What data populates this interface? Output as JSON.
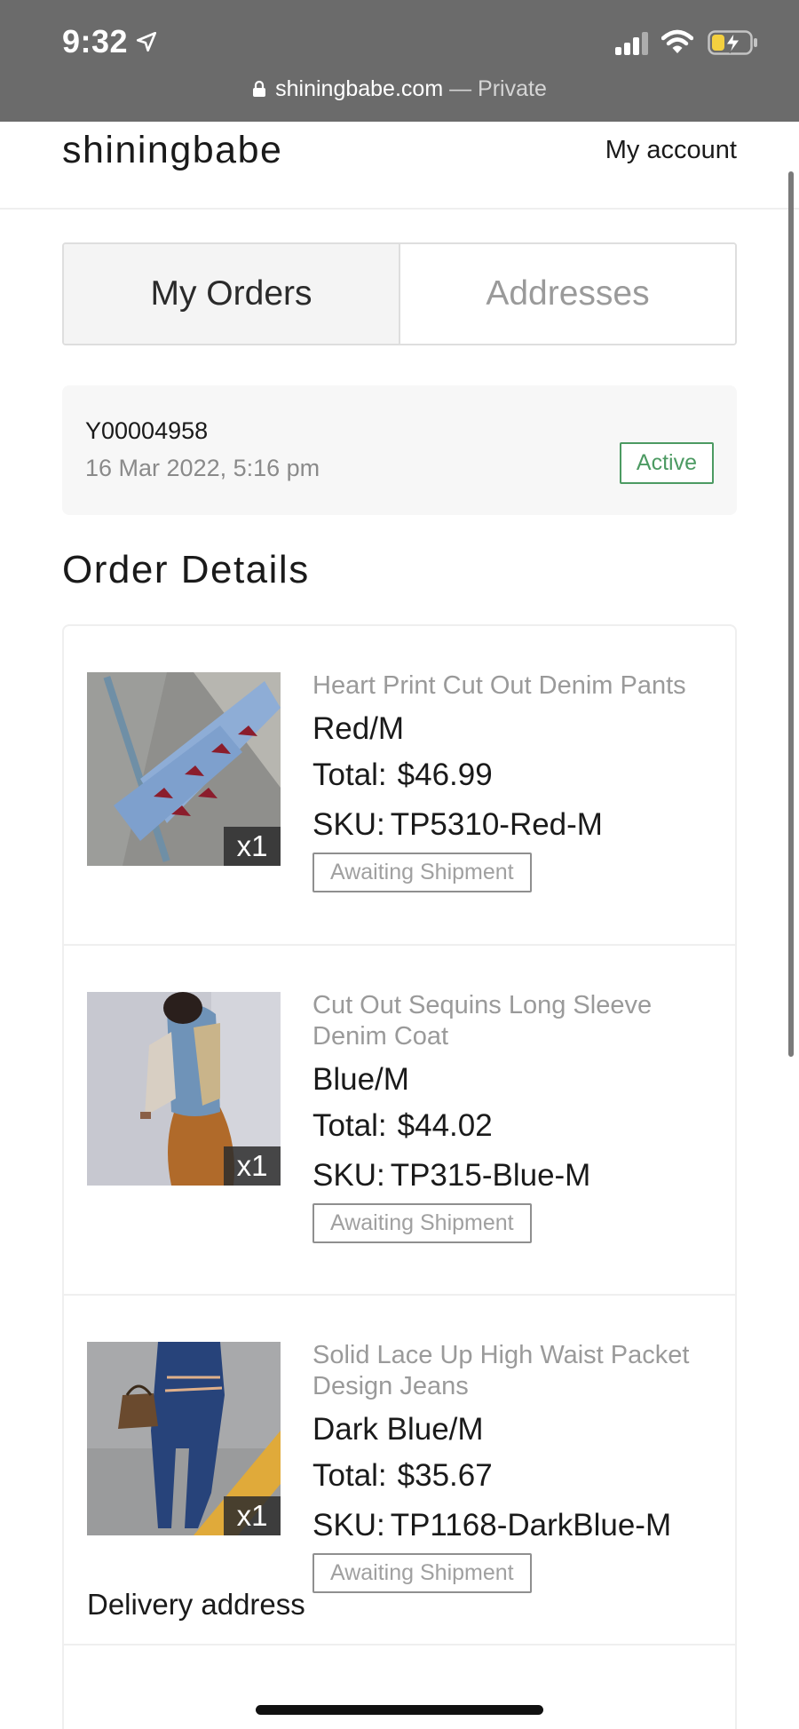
{
  "status_bar": {
    "time": "9:32"
  },
  "url_bar": {
    "domain": "shiningbabe.com",
    "separator": "—",
    "mode": "Private"
  },
  "header": {
    "brand": "shiningbabe",
    "account_link": "My account"
  },
  "tabs": [
    {
      "label": "My Orders",
      "active": true
    },
    {
      "label": "Addresses",
      "active": false
    }
  ],
  "order": {
    "id": "Y00004958",
    "date": "16 Mar 2022, 5:16 pm",
    "status": "Active",
    "status_color": "#4c9a62"
  },
  "section_title": "Order Details",
  "items": [
    {
      "name": "Heart Print Cut Out Denim Pants",
      "variant": "Red/M",
      "total_label": "Total:",
      "total": "$46.99",
      "sku_label": "SKU:",
      "sku": "TP5310-Red-M",
      "status": "Awaiting Shipment",
      "qty": "x1",
      "image": "heart-print-denim-pants-photo"
    },
    {
      "name": "Cut Out Sequins Long Sleeve Denim Coat",
      "variant": "Blue/M",
      "total_label": "Total:",
      "total": "$44.02",
      "sku_label": "SKU:",
      "sku": "TP315-Blue-M",
      "status": "Awaiting Shipment",
      "qty": "x1",
      "image": "sequins-denim-coat-photo"
    },
    {
      "name": "Solid Lace Up High Waist Packet Design Jeans",
      "variant": "Dark Blue/M",
      "total_label": "Total:",
      "total": "$35.67",
      "sku_label": "SKU:",
      "sku": "TP1168-DarkBlue-M",
      "status": "Awaiting Shipment",
      "qty": "x1",
      "image": "lace-up-jeans-photo"
    }
  ],
  "delivery": {
    "title": "Delivery address"
  }
}
